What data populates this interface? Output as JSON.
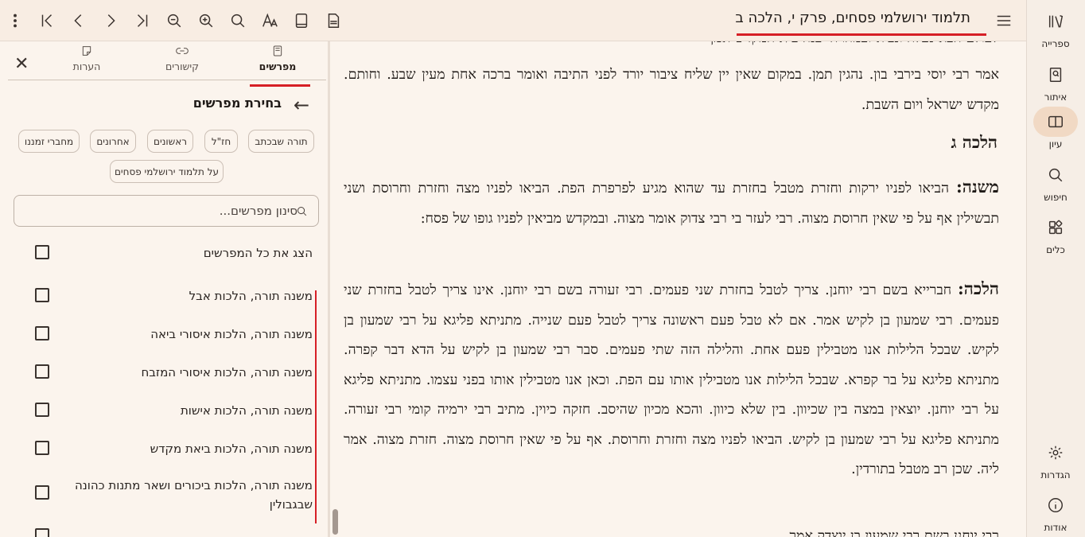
{
  "rail": {
    "library": "ספרייה",
    "locate": "איתור",
    "study": "עיון",
    "search": "חיפוש",
    "tools": "כלים",
    "settings": "הגדרות",
    "about": "אודות"
  },
  "document": {
    "title": "תלמוד ירושלמי פסחים, פרק י, הלכה ב",
    "cut_top": "לעולם הבא נעלה ונביא ובמהרה יבנה בית המקדש אמן",
    "para1": "אמר רבי יוסי בירבי בון. נהגין תמן. במקום שאין יין שליח ציבור יורד לפני התיבה ואומר ברכה אחת מעין שבע. וחותם. מקדש ישראל ויום השבת.",
    "heading": "הלכה ג",
    "mishnah_label": "משנה:",
    "mishnah": "הביאו לפניו ירקות וחזרת מטבל בחזרת עד שהוא מגיע לפרפרת הפת. הביאו לפניו מצה וחזרת וחרוסת ושני תבשילין אף על פי שאין חרוסת מצוה. רבי לעזר בי רבי צדוק אומר מצוה. ובמקדש מביאין לפניו גופו של פסח:",
    "halakha_label": "הלכה:",
    "halakha": "חברייא בשם רבי יוחנן. צריך לטבל בחזרת שני פעמים. רבי זעורה בשם רבי יוחנן. אינו צריך לטבל בחזרת שני פעמים. רבי שמעון בן לקיש אמר. אם לא טבל פעם ראשונה צריך לטבל פעם שנייה. מתניתא פליגא על רבי שמעון בן לקיש. שבכל הלילות אנו מטבילין פעם אחת. והלילה הזה שתי פעמים. סבר רבי שמעון בן לקיש על הדא דבר קפרה. מתניתא פליגא על בר קפרא. שבכל הלילות אנו מטבילין אותו עם הפת. וכאן אנו מטבילין אותו בפני עצמו. מתניתא פליגא על רבי יוחנן. יוצאין במצה בין שכיוון. בין שלא כיוון. והכא מכיון שהיסב. חזקה כיוין. מתיב רבי ירמיה קומי רבי זעורה. מתניתא פליגא על רבי שמעון בן לקיש. הביאו לפניו מצה וחזרת וחרוסת. אף על פי שאין חרוסת מצוה. חזרת מצוה. אמר ליה. שכן רב מטבל בתורדין.",
    "cut_bottom": "רבי יוחנן בשם רבי שמעון בן יוצדק אמר"
  },
  "panel": {
    "tabs": {
      "commentaries": "מפרשים",
      "links": "קישורים",
      "notes": "הערות"
    },
    "selection_title": "בחירת מפרשים",
    "chips": {
      "torah": "תורה שבכתב",
      "chazal": "חז\"ל",
      "rishonim": "ראשונים",
      "acharonim": "אחרונים",
      "modern": "מחברי זמננו",
      "on_text": "על תלמוד ירושלמי פסחים"
    },
    "filter_placeholder": "סינון מפרשים...",
    "show_all": "הצג את כל המפרשים",
    "items": [
      "משנה תורה, הלכות אבל",
      "משנה תורה, הלכות איסורי ביאה",
      "משנה תורה, הלכות איסורי המזבח",
      "משנה תורה, הלכות אישות",
      "משנה תורה, הלכות ביאת מקדש",
      "משנה תורה, הלכות ביכורים ושאר מתנות כהונה שבגבולין"
    ]
  },
  "accent_color": "#d61f26"
}
